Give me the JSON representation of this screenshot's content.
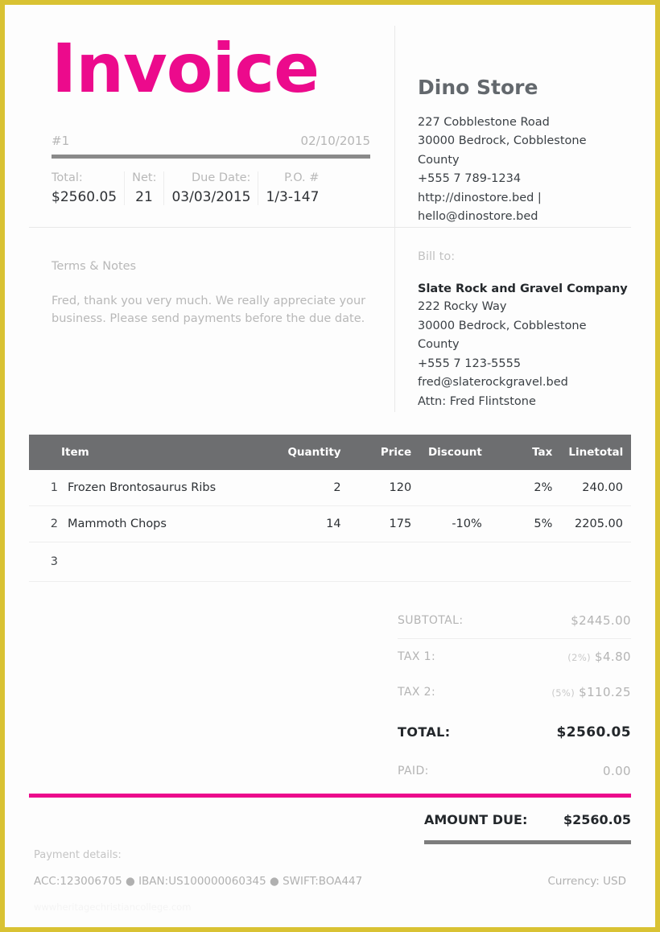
{
  "theme": {
    "accent": "#ec0a8c",
    "border": "#d9c233",
    "table_header_bg": "#6d6e70",
    "rule_gray": "#8a8a8a"
  },
  "header": {
    "title": "Invoice",
    "number": "#1",
    "date": "02/10/2015",
    "meta": [
      {
        "label": "Total:",
        "value": "$2560.05"
      },
      {
        "label": "Net:",
        "value": "21"
      },
      {
        "label": "Due Date:",
        "value": "03/03/2015"
      },
      {
        "label": "P.O. #",
        "value": "1/3-147"
      }
    ]
  },
  "seller": {
    "name": "Dino Store",
    "lines": [
      "227 Cobblestone Road",
      "30000 Bedrock, Cobblestone County",
      "+555 7 789-1234",
      "http://dinostore.bed |",
      "hello@dinostore.bed"
    ]
  },
  "terms": {
    "label": "Terms & Notes",
    "text": "Fred, thank you very much. We really appreciate your business. Please send payments before the due date."
  },
  "bill_to": {
    "label": "Bill to:",
    "company": "Slate Rock and Gravel Company",
    "lines": [
      "222 Rocky Way",
      "30000 Bedrock, Cobblestone County",
      "+555 7 123-5555",
      "fred@slaterockgravel.bed",
      "Attn: Fred Flintstone"
    ]
  },
  "items_table": {
    "columns": [
      "Item",
      "Quantity",
      "Price",
      "Discount",
      "Tax",
      "Linetotal"
    ],
    "rows": [
      {
        "index": "1",
        "item": "Frozen Brontosaurus Ribs",
        "quantity": "2",
        "price": "120",
        "discount": "",
        "tax": "2%",
        "linetotal": "240.00"
      },
      {
        "index": "2",
        "item": "Mammoth Chops",
        "quantity": "14",
        "price": "175",
        "discount": "-10%",
        "tax": "5%",
        "linetotal": "2205.00"
      },
      {
        "index": "3",
        "item": "",
        "quantity": "",
        "price": "",
        "discount": "",
        "tax": "",
        "linetotal": ""
      }
    ]
  },
  "totals": {
    "subtotal_label": "SUBTOTAL:",
    "subtotal_value": "$2445.00",
    "tax1_label": "TAX 1:",
    "tax1_pct": "(2%)",
    "tax1_value": "$4.80",
    "tax2_label": "TAX 2:",
    "tax2_pct": "(5%)",
    "tax2_value": "$110.25",
    "total_label": "TOTAL:",
    "total_value": "$2560.05",
    "paid_label": "PAID:",
    "paid_value": "0.00",
    "due_label": "AMOUNT DUE:",
    "due_value": "$2560.05"
  },
  "footer": {
    "payment_label": "Payment details:",
    "payment_details": "ACC:123006705 ● IBAN:US100000060345 ● SWIFT:BOA447",
    "currency": "Currency: USD",
    "watermark": "wwwheritagechristiancollege.com"
  }
}
